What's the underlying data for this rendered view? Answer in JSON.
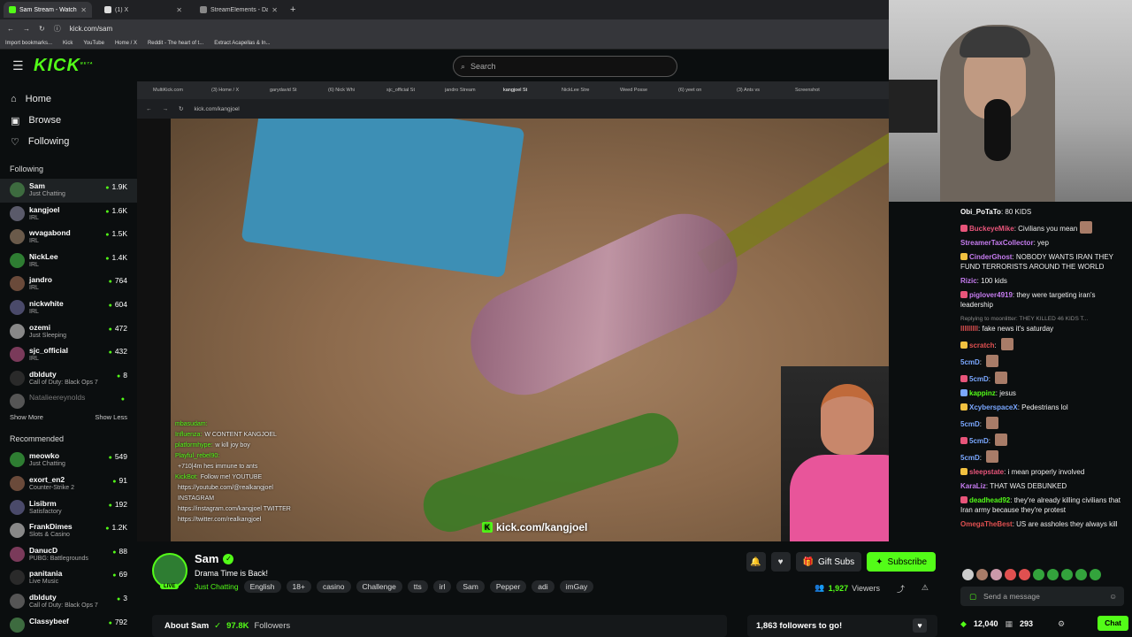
{
  "browser": {
    "tabs": [
      {
        "label": "Sam Stream - Watch Live on Ki",
        "icon": "kick-icon",
        "active": true
      },
      {
        "label": "(1) X",
        "icon": "x-icon",
        "active": false
      },
      {
        "label": "StreamElements - Dashboard",
        "icon": "streamelements-icon",
        "active": false
      }
    ],
    "url": "kick.com/sam",
    "bookmarks": [
      "Import bookmarks...",
      "Kick",
      "YouTube",
      "Home / X",
      "Reddit - The heart of t...",
      "Extract Acapellas & In..."
    ]
  },
  "header": {
    "logo": "KICK",
    "logo_beta": "BETA",
    "search_placeholder": "Search"
  },
  "sidebar": {
    "nav": [
      {
        "label": "Home",
        "icon": "home-icon"
      },
      {
        "label": "Browse",
        "icon": "browse-icon"
      },
      {
        "label": "Following",
        "icon": "heart-icon"
      }
    ],
    "following_title": "Following",
    "following": [
      {
        "name": "Sam",
        "category": "Just Chatting",
        "viewers": "1.9K"
      },
      {
        "name": "kangjoel",
        "category": "IRL",
        "viewers": "1.6K"
      },
      {
        "name": "wvagabond",
        "category": "IRL",
        "viewers": "1.5K"
      },
      {
        "name": "NickLee",
        "category": "IRL",
        "viewers": "1.4K"
      },
      {
        "name": "jandro",
        "category": "IRL",
        "viewers": "764"
      },
      {
        "name": "nickwhite",
        "category": "IRL",
        "viewers": "604"
      },
      {
        "name": "ozemi",
        "category": "Just Sleeping",
        "viewers": "472"
      },
      {
        "name": "sjc_official",
        "category": "IRL",
        "viewers": "432"
      },
      {
        "name": "dbldut​y",
        "category": "Call of Duty: Black Ops 7",
        "viewers": "8"
      },
      {
        "name": "Natalieereynolds",
        "category": "",
        "viewers": ""
      }
    ],
    "show_more": "Show More",
    "show_less": "Show Less",
    "recommended_title": "Recommended",
    "recommended": [
      {
        "name": "meowko",
        "category": "Just Chatting",
        "viewers": "549"
      },
      {
        "name": "exort_en2",
        "category": "Counter-Strike 2",
        "viewers": "91"
      },
      {
        "name": "Lisibrm",
        "category": "Satisfactory",
        "viewers": "192"
      },
      {
        "name": "FrankDimes",
        "category": "Slots & Casino",
        "viewers": "1.2K"
      },
      {
        "name": "DanucD",
        "category": "PUBG: Battlegrounds",
        "viewers": "88"
      },
      {
        "name": "panitania",
        "category": "Live Music",
        "viewers": "69"
      },
      {
        "name": "dbldut​y",
        "category": "Call of Duty: Black Ops 7",
        "viewers": "3"
      },
      {
        "name": "Classybeef",
        "category": "",
        "viewers": "792"
      }
    ]
  },
  "player": {
    "inner_tabs": [
      "MultiKick.com",
      "(3) Home / X",
      "garydavid St",
      "(6) Nick Whi",
      "sjc_official St",
      "jandro Stream",
      "kangjoel St",
      "NickLee Stre",
      "Weed Posse",
      "(6) yeet on",
      "(3) Ants vs",
      "Screenshot"
    ],
    "inner_url": "kick.com/kangjoel",
    "overlay_chat": [
      {
        "user": "mbasudam:",
        "text": ""
      },
      {
        "user": "Influenza:",
        "text": "W CONTENT KANGJOEL"
      },
      {
        "user": "platformhype:",
        "text": "w kill joy boy"
      },
      {
        "user": "Playful_rebel90:",
        "text": ""
      },
      {
        "user": "",
        "text": "+710|4m hes immune to ants"
      },
      {
        "user": "KickBot:",
        "text": "Follow me! YOUTUBE"
      },
      {
        "user": "",
        "text": "https://youtube.com/@realkangjoel"
      },
      {
        "user": "",
        "text": "INSTAGRAM"
      },
      {
        "user": "",
        "text": "https://instagram.com/kangjoel TWITTER"
      },
      {
        "user": "",
        "text": "https://twitter.com/realkangjoel"
      }
    ],
    "watermark": "kick.com/kangjoel"
  },
  "stream": {
    "name": "Sam",
    "live_label": "LIVE",
    "title": "Drama Time is Back!",
    "category": "Just Chatting",
    "tags": [
      "English",
      "18+",
      "casino",
      "Challenge",
      "tts",
      "irl",
      "Sam",
      "Pepper",
      "adi",
      "imGay"
    ],
    "gift_label": "Gift Subs",
    "subscribe_label": "Subscribe",
    "viewers": "1,927",
    "viewers_label": "Viewers",
    "about_label": "About Sam",
    "followers_count": "97.8K",
    "followers_label": "Followers",
    "goal_text": "1,863 followers to go!"
  },
  "chat": {
    "messages": [
      {
        "user": "Obi_PoTaTo",
        "color": "#ffffff",
        "text": "80 KIDS"
      },
      {
        "user": "BuckeyeMike",
        "color": "#e8557a",
        "text": "Civilians you mean"
      },
      {
        "user": "StreamerTaxCollector",
        "color": "#c67cf0",
        "text": "yep"
      },
      {
        "user": "CinderGhost",
        "color": "#c67cf0",
        "text": "NOBODY WANTS IRAN THEY FUND TERRORISTS AROUND THE WORLD"
      },
      {
        "user": "Rizic",
        "color": "#c67cf0",
        "text": "100 kids"
      },
      {
        "user": "piglover4919",
        "color": "#c67cf0",
        "text": "they were targeting iran's leadership"
      },
      {
        "user": "lllllllll",
        "color": "#e05050",
        "text": "fake news it's saturday"
      },
      {
        "user": "scratch",
        "color": "#e05050",
        "text": ""
      },
      {
        "user": "5cmD",
        "color": "#7aa7ff",
        "text": ""
      },
      {
        "user": "5cmD",
        "color": "#7aa7ff",
        "text": ""
      },
      {
        "user": "kappinz",
        "color": "#53fc18",
        "text": "jesus"
      },
      {
        "user": "XcyberspaceX",
        "color": "#7aa7ff",
        "text": "Pedestrians lol"
      },
      {
        "user": "5cmD",
        "color": "#7aa7ff",
        "text": ""
      },
      {
        "user": "5cmD",
        "color": "#7aa7ff",
        "text": ""
      },
      {
        "user": "5cmD",
        "color": "#7aa7ff",
        "text": ""
      },
      {
        "user": "sleepstate",
        "color": "#e8557a",
        "text": "i mean properly involved"
      },
      {
        "user": "KaraLiz",
        "color": "#c67cf0",
        "text": "THAT WAS DEBUNKED"
      },
      {
        "user": "deadhead92",
        "color": "#53fc18",
        "text": "they're already killing civilians that Iran army because they're protest"
      },
      {
        "user": "OmegaTheBest",
        "color": "#e05050",
        "text": "US are assholes they always kill"
      }
    ],
    "reply_text": "Replying to moonlitter: THEY KILLED 46 KIDS T...",
    "input_placeholder": "Send a message",
    "kicks": "12,040",
    "points": "293",
    "chat_button": "Chat"
  }
}
